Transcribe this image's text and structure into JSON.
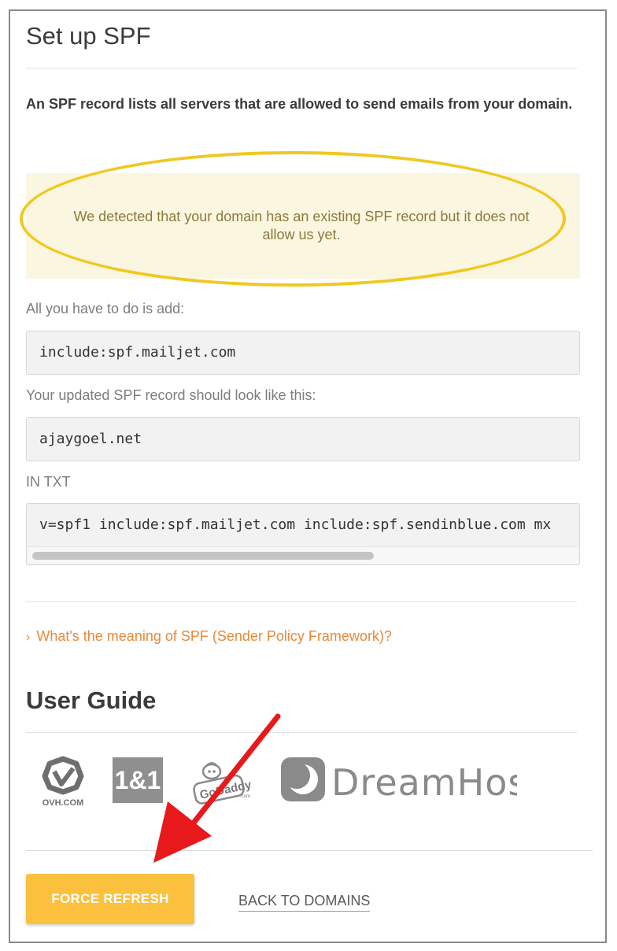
{
  "page": {
    "title": "Set up SPF",
    "intro": "An SPF record lists all servers that are allowed to send emails from your domain."
  },
  "notice": {
    "text": "We detected that your domain has an existing SPF record but it does not allow us yet.",
    "highlight_color": "#f0c820"
  },
  "instructions": {
    "add_label": "All you have to do is add:",
    "add_value": "include:spf.mailjet.com",
    "updated_label": "Your updated SPF record should look like this:",
    "domain_value": "ajaygoel.net",
    "type_label": "IN TXT",
    "txt_value": "v=spf1 include:spf.mailjet.com include:spf.sendinblue.com mx"
  },
  "faq": {
    "link": "What's the meaning of SPF (Sender Policy Framework)?"
  },
  "guide": {
    "title": "User Guide",
    "providers": [
      {
        "name": "OVH.COM"
      },
      {
        "name": "1&1"
      },
      {
        "name": "GoDaddy",
        "suffix": ".com"
      },
      {
        "name": "DreamHost"
      }
    ]
  },
  "actions": {
    "force_refresh": "FORCE REFRESH",
    "back": "BACK TO DOMAINS"
  },
  "colors": {
    "accent_button": "#fbc13e",
    "link": "#e8893a",
    "arrow": "#e8191b"
  }
}
